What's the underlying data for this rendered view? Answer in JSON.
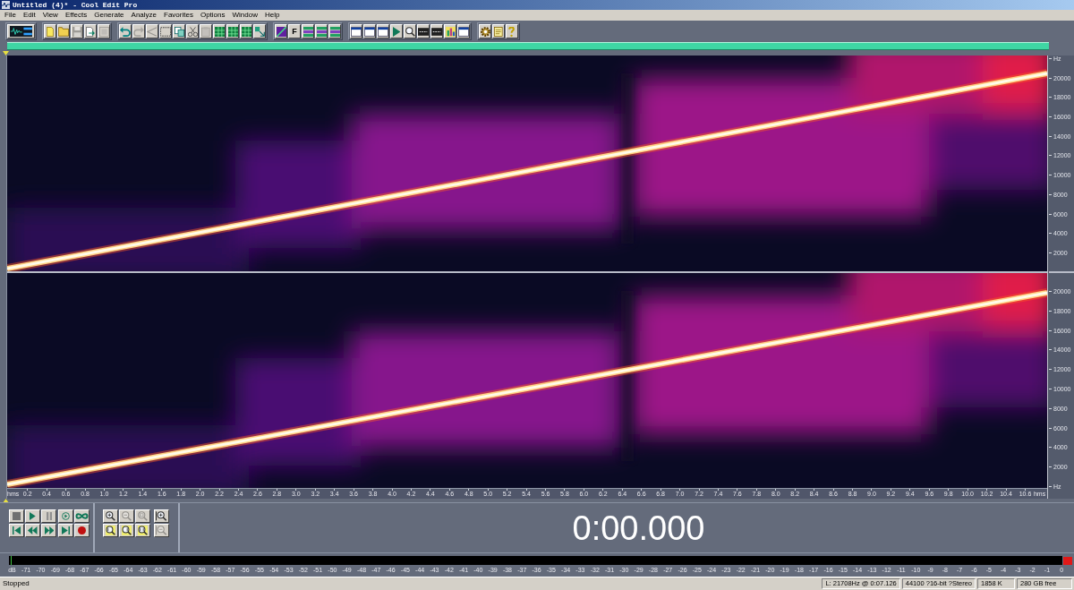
{
  "window": {
    "title": "Untitled (4)* - Cool Edit Pro"
  },
  "menu": [
    "File",
    "Edit",
    "View",
    "Effects",
    "Generate",
    "Analyze",
    "Favorites",
    "Options",
    "Window",
    "Help"
  ],
  "toolbar": [
    [
      {
        "kind": "mode",
        "disabled": false
      }
    ],
    [
      {
        "kind": "new",
        "disabled": false
      },
      {
        "kind": "open",
        "disabled": false
      },
      {
        "kind": "save",
        "disabled": true
      },
      {
        "kind": "saveas",
        "disabled": false
      },
      {
        "kind": "frame",
        "disabled": true
      }
    ],
    [
      {
        "kind": "undo",
        "disabled": false
      },
      {
        "kind": "redo",
        "disabled": true
      },
      {
        "kind": "fork",
        "disabled": true
      },
      {
        "kind": "select",
        "disabled": false
      },
      {
        "kind": "copy",
        "disabled": false
      },
      {
        "kind": "cut",
        "disabled": false
      },
      {
        "kind": "paste",
        "disabled": true
      },
      {
        "kind": "grid",
        "disabled": false
      },
      {
        "kind": "grid",
        "disabled": false
      },
      {
        "kind": "grid",
        "disabled": false
      },
      {
        "kind": "mixpaste",
        "disabled": false
      }
    ],
    [
      {
        "kind": "spectral",
        "disabled": false
      },
      {
        "kind": "letter",
        "label": "F",
        "disabled": false
      },
      {
        "kind": "bars",
        "disabled": false
      },
      {
        "kind": "bars",
        "disabled": false
      },
      {
        "kind": "bars",
        "disabled": false
      }
    ],
    [
      {
        "kind": "window",
        "disabled": false
      },
      {
        "kind": "window",
        "disabled": false
      },
      {
        "kind": "window",
        "disabled": false
      },
      {
        "kind": "play",
        "disabled": false
      },
      {
        "kind": "zoom",
        "disabled": false
      },
      {
        "kind": "counter",
        "disabled": false
      },
      {
        "kind": "counter",
        "disabled": false
      },
      {
        "kind": "chart",
        "disabled": false
      },
      {
        "kind": "window",
        "disabled": false
      }
    ],
    [
      {
        "kind": "gear",
        "disabled": false
      },
      {
        "kind": "notes",
        "disabled": false
      },
      {
        "kind": "help",
        "disabled": false
      }
    ]
  ],
  "channels": [
    {
      "axis_labels": [
        "Hz",
        "20000",
        "18000",
        "16000",
        "14000",
        "12000",
        "10000",
        "8000",
        "6000",
        "4000",
        "2000"
      ]
    },
    {
      "axis_labels": [
        "20000",
        "18000",
        "16000",
        "14000",
        "12000",
        "10000",
        "8000",
        "6000",
        "4000",
        "2000",
        "Hz"
      ]
    }
  ],
  "time_axis": [
    "hms",
    "0.2",
    "0.4",
    "0.6",
    "0.8",
    "1.0",
    "1.2",
    "1.4",
    "1.6",
    "1.8",
    "2.0",
    "2.2",
    "2.4",
    "2.6",
    "2.8",
    "3.0",
    "3.2",
    "3.4",
    "3.6",
    "3.8",
    "4.0",
    "4.2",
    "4.4",
    "4.6",
    "4.8",
    "5.0",
    "5.2",
    "5.4",
    "5.6",
    "5.8",
    "6.0",
    "6.2",
    "6.4",
    "6.6",
    "6.8",
    "7.0",
    "7.2",
    "7.4",
    "7.6",
    "7.8",
    "8.0",
    "8.2",
    "8.4",
    "8.6",
    "8.8",
    "9.0",
    "9.2",
    "9.4",
    "9.6",
    "9.8",
    "10.0",
    "10.2",
    "10.4",
    "10.6",
    "hms"
  ],
  "transport": [
    {
      "kind": "stop",
      "disabled": false
    },
    {
      "kind": "play",
      "disabled": false
    },
    {
      "kind": "pause",
      "disabled": false
    },
    {
      "kind": "playloop",
      "disabled": false
    },
    {
      "kind": "loop",
      "disabled": false
    },
    {
      "kind": "start",
      "disabled": false
    },
    {
      "kind": "rewind",
      "disabled": false
    },
    {
      "kind": "forward",
      "disabled": false
    },
    {
      "kind": "end",
      "disabled": false
    },
    {
      "kind": "record",
      "disabled": false
    }
  ],
  "zoom_buttons": [
    [
      {
        "kind": "zoomin",
        "disabled": false
      },
      {
        "kind": "zoomout",
        "disabled": true
      },
      {
        "kind": "zoomfull",
        "disabled": true
      },
      {
        "kind": "zoomleft",
        "disabled": false
      },
      {
        "kind": "zoomright",
        "disabled": false
      },
      {
        "kind": "zoomsel",
        "disabled": false
      }
    ],
    [
      {
        "kind": "zoomvin",
        "disabled": false
      },
      {
        "kind": "zoomvout",
        "disabled": true
      }
    ]
  ],
  "time_display": "0:00.000",
  "level_meter": {
    "clip": true,
    "labels": [
      "dB",
      "-71",
      "-70",
      "-69",
      "-68",
      "-67",
      "-66",
      "-65",
      "-64",
      "-63",
      "-62",
      "-61",
      "-60",
      "-59",
      "-58",
      "-57",
      "-56",
      "-55",
      "-54",
      "-53",
      "-52",
      "-51",
      "-50",
      "-49",
      "-48",
      "-47",
      "-46",
      "-45",
      "-44",
      "-43",
      "-42",
      "-41",
      "-40",
      "-39",
      "-38",
      "-37",
      "-36",
      "-35",
      "-34",
      "-33",
      "-32",
      "-31",
      "-30",
      "-29",
      "-28",
      "-27",
      "-26",
      "-25",
      "-24",
      "-23",
      "-22",
      "-21",
      "-20",
      "-19",
      "-18",
      "-17",
      "-16",
      "-15",
      "-14",
      "-13",
      "-12",
      "-11",
      "-10",
      "-9",
      "-8",
      "-7",
      "-6",
      "-5",
      "-4",
      "-3",
      "-2",
      "-1",
      "0"
    ]
  },
  "status_bar": {
    "state": "Stopped",
    "fields": [
      "L: 21708Hz @ 0:07.126",
      "44100 ?16-bit ?Stereo",
      "1858 K",
      "280 GB free"
    ]
  }
}
